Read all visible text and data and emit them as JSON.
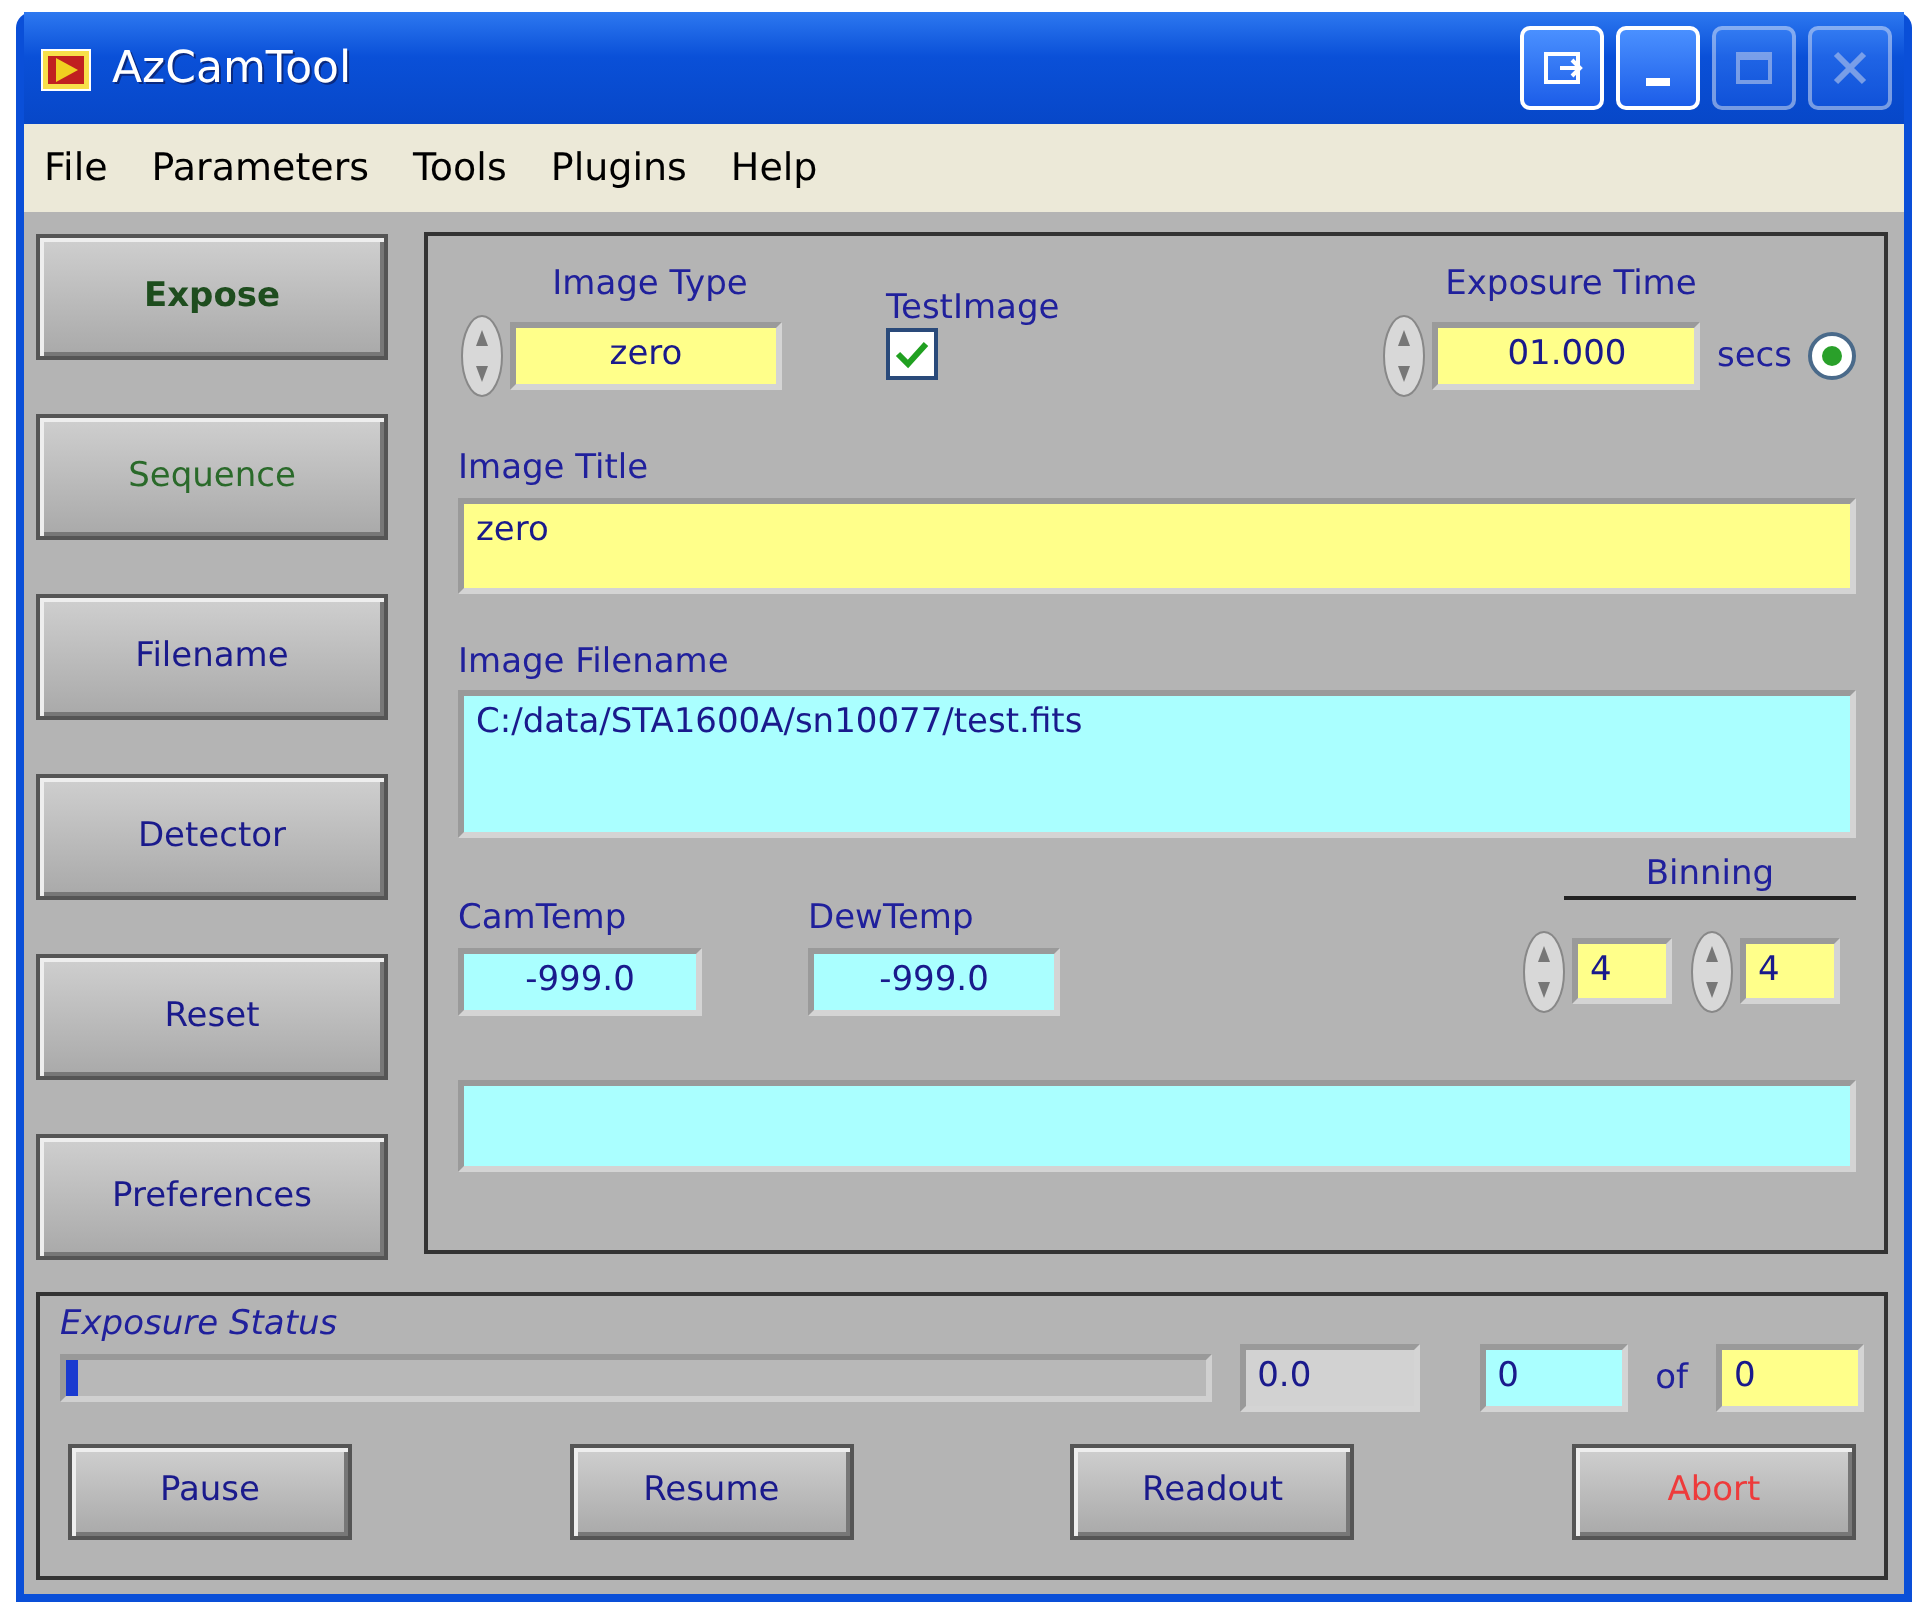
{
  "window": {
    "title": "AzCamTool",
    "controls": [
      {
        "kind": "dock",
        "disabled": false
      },
      {
        "kind": "minimize",
        "disabled": false
      },
      {
        "kind": "maximize",
        "disabled": true
      },
      {
        "kind": "close",
        "disabled": true
      }
    ]
  },
  "menu": [
    "File",
    "Parameters",
    "Tools",
    "Plugins",
    "Help"
  ],
  "side_buttons": [
    {
      "label": "Expose",
      "color": "#1e4d1e",
      "bold": true
    },
    {
      "label": "Sequence",
      "color": "#2a6a2a",
      "bold": false
    },
    {
      "label": "Filename",
      "color": "#1a1a8c",
      "bold": false
    },
    {
      "label": "Detector",
      "color": "#1a1a8c",
      "bold": false
    },
    {
      "label": "Reset",
      "color": "#1a1a8c",
      "bold": false
    },
    {
      "label": "Preferences",
      "color": "#1a1a8c",
      "bold": false
    }
  ],
  "image_type": {
    "label": "Image Type",
    "value": "zero"
  },
  "test_image": {
    "label": "TestImage",
    "checked": true
  },
  "exposure_time": {
    "label": "Exposure Time",
    "value": "01.000",
    "unit": "secs",
    "selected": true
  },
  "image_title": {
    "label": "Image Title",
    "value": "zero"
  },
  "image_filename": {
    "label": "Image Filename",
    "value": "C:/data/STA1600A/sn10077/test.fits"
  },
  "cam_temp": {
    "label": "CamTemp",
    "value": "-999.0"
  },
  "dew_temp": {
    "label": "DewTemp",
    "value": "-999.0"
  },
  "binning": {
    "label": "Binning",
    "values": [
      "4",
      "4"
    ]
  },
  "exposure_status": {
    "label": "Exposure Status",
    "level": 0.01,
    "elapsed": "0.0",
    "current": "0",
    "of": "of",
    "total": "0"
  },
  "bottom_buttons": [
    {
      "label": "Pause",
      "color": "#1a1a8c"
    },
    {
      "label": "Resume",
      "color": "#1a1a8c"
    },
    {
      "label": "Readout",
      "color": "#1a1a8c"
    },
    {
      "label": "Abort",
      "color": "#ee3b3b"
    }
  ]
}
